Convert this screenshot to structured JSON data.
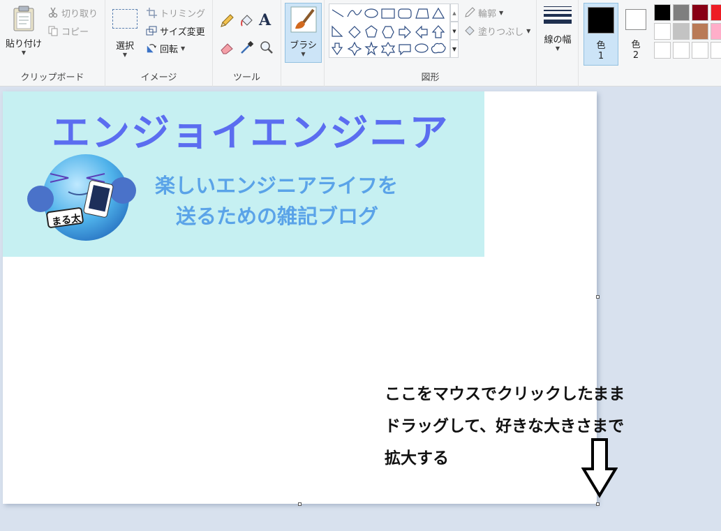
{
  "ribbon": {
    "clipboard": {
      "label": "クリップボード",
      "paste": "貼り付け",
      "cut": "切り取り",
      "copy": "コピー"
    },
    "image": {
      "label": "イメージ",
      "select": "選択",
      "crop": "トリミング",
      "resize": "サイズ変更",
      "rotate": "回転"
    },
    "tools": {
      "label": "ツール"
    },
    "brush": {
      "label": "ブラシ"
    },
    "shapes": {
      "label": "図形",
      "outline": "輪郭",
      "fill": "塗りつぶし"
    },
    "size": {
      "label": "線の幅"
    },
    "color1": {
      "label": "色",
      "num": "1",
      "value": "#000000"
    },
    "color2": {
      "label": "色",
      "num": "2",
      "value": "#ffffff"
    },
    "palette": [
      "#000000",
      "#7f7f7f",
      "#880015",
      "#ed1c24",
      "#ffffff",
      "#c3c3c3",
      "#b97a57",
      "#ffaec9",
      "#ffffff",
      "#ffffff",
      "#ffffff",
      "#ffffff"
    ]
  },
  "canvas": {
    "banner": {
      "title": "エンジョイエンジニア",
      "subtitle_line1": "楽しいエンジニアライフを",
      "subtitle_line2": "送るための雑記ブログ",
      "mascot_tag": "まる太"
    },
    "instruction": {
      "line1": "ここをマウスでクリックしたまま",
      "line2": "ドラッグして、好きな大きさまで",
      "line3": "拡大する"
    }
  }
}
